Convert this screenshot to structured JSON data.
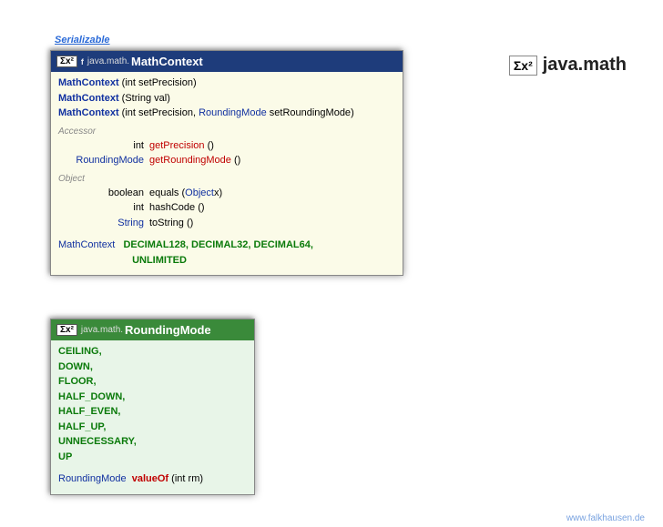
{
  "top_link": "Serializable",
  "package_title": "java.math",
  "sigma_glyph": "Σx²",
  "f_badge": "f",
  "box1": {
    "pkg": "java.math.",
    "name": "MathContext",
    "ctors": [
      {
        "name": "MathContext",
        "params": [
          {
            "type": "int",
            "name": "setPrecision"
          }
        ]
      },
      {
        "name": "MathContext",
        "params": [
          {
            "type": "String",
            "name": "val"
          }
        ]
      },
      {
        "name": "MathContext",
        "params": [
          {
            "type": "int",
            "name": "setPrecision"
          },
          {
            "type_link": "RoundingMode",
            "name": "setRoundingMode"
          }
        ]
      }
    ],
    "accessor_label": "Accessor",
    "accessors": [
      {
        "ret": "int",
        "ret_plain": true,
        "name": "getPrecision",
        "params": "()"
      },
      {
        "ret": "RoundingMode",
        "ret_plain": false,
        "name": "getRoundingMode",
        "params": "()"
      }
    ],
    "object_label": "Object",
    "object_methods": [
      {
        "ret": "boolean",
        "name": "equals",
        "params_html": [
          {
            "paren": "("
          },
          {
            "type_link": "Object"
          },
          {
            "txt": " x"
          },
          {
            "paren": ")"
          }
        ]
      },
      {
        "ret": "int",
        "name": "hashCode",
        "params": "()"
      },
      {
        "ret": "String",
        "ret_link": true,
        "name": "toString",
        "params": "()"
      }
    ],
    "const_type": "MathContext",
    "constants": [
      "DECIMAL128",
      "DECIMAL32",
      "DECIMAL64",
      "UNLIMITED"
    ]
  },
  "box2": {
    "pkg": "java.math.",
    "name": "RoundingMode",
    "enum_values": [
      "CEILING",
      "DOWN",
      "FLOOR",
      "HALF_DOWN",
      "HALF_EVEN",
      "HALF_UP",
      "UNNECESSARY",
      "UP"
    ],
    "method": {
      "ret": "RoundingMode",
      "name": "valueOf",
      "param_type": "int",
      "param_name": "rm"
    }
  },
  "footer": "www.falkhausen.de"
}
